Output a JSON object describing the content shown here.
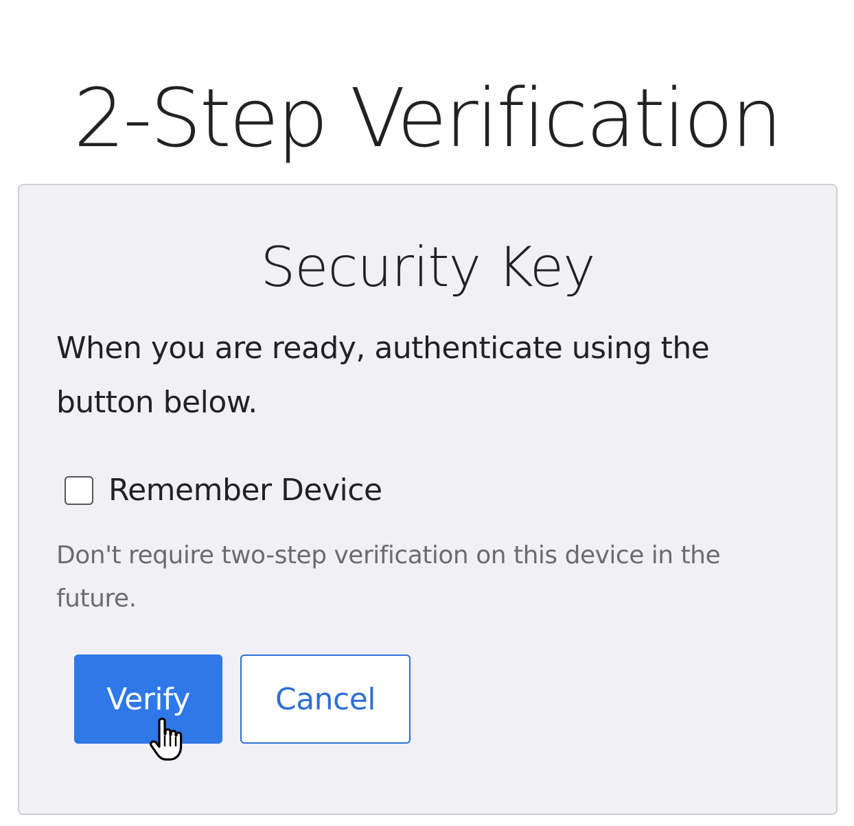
{
  "header": {
    "title": "2-Step Verification"
  },
  "card": {
    "title": "Security Key",
    "instructions": "When you are ready, authenticate using the button below.",
    "remember_device": {
      "label": "Remember Device",
      "checked": false,
      "help_text": "Don't require two-step verification on this device in the future."
    },
    "buttons": {
      "verify_label": "Verify",
      "cancel_label": "Cancel"
    }
  },
  "colors": {
    "primary": "#2f78e8",
    "card_background": "#f0f0f5",
    "help_text": "#6b6b70"
  },
  "cursor_icon": "hand-pointer-icon"
}
